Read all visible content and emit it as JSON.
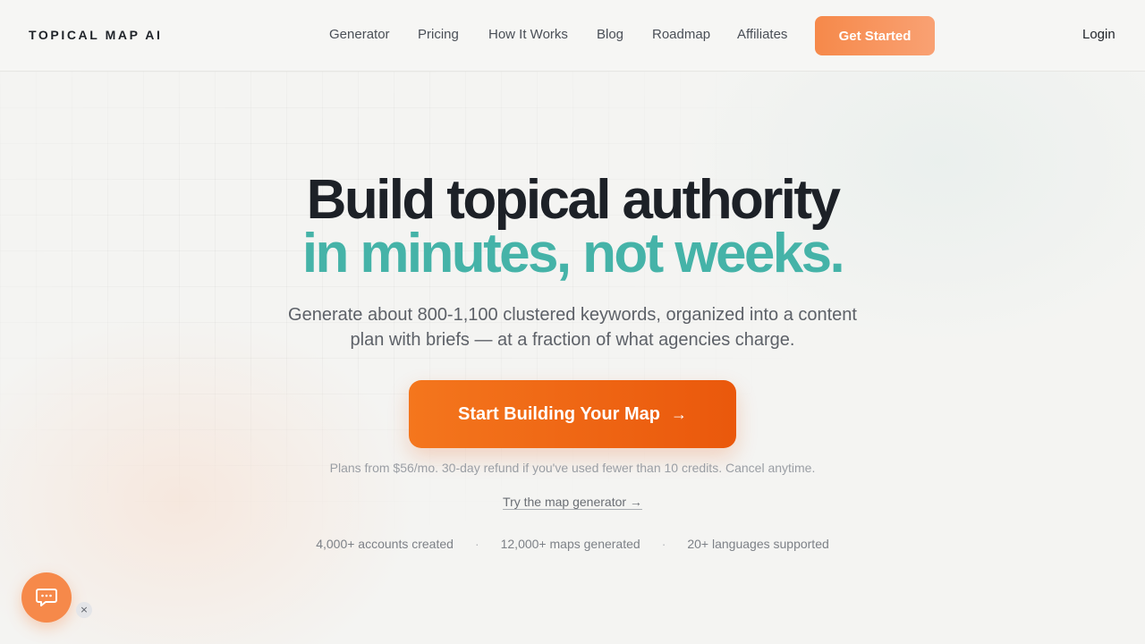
{
  "brand": {
    "logo": "TOPICAL MAP AI"
  },
  "nav": {
    "items": [
      "Generator",
      "Pricing",
      "How It Works",
      "Blog",
      "Roadmap",
      "Affiliates"
    ],
    "cta": "Get Started",
    "login": "Login"
  },
  "hero": {
    "headline_line1": "Build topical authority",
    "headline_line2": "in minutes, not weeks.",
    "subtitle_line1": "Generate about 800-1,100 clustered keywords, organized into a content",
    "subtitle_line2": "plan with briefs — at a fraction of what agencies charge.",
    "cta_label": "Start Building Your Map",
    "cta_arrow": "→",
    "fine_print": "Plans from $56/mo. 30-day refund if you've used fewer than 10 credits. Cancel anytime.",
    "try_link": "Try the map generator →",
    "stats": [
      "4,000+ accounts created",
      "12,000+ maps generated",
      "20+ languages supported"
    ],
    "separator": "·"
  },
  "chat": {
    "close": "×"
  },
  "colors": {
    "accent_orange": "#ea580c",
    "nav_cta_orange": "#f6894a",
    "headline_teal": "#45b3a8",
    "headline_dark": "#1d2127"
  },
  "icons": {
    "chat": "chat-bubble-icon",
    "close": "close-icon"
  }
}
